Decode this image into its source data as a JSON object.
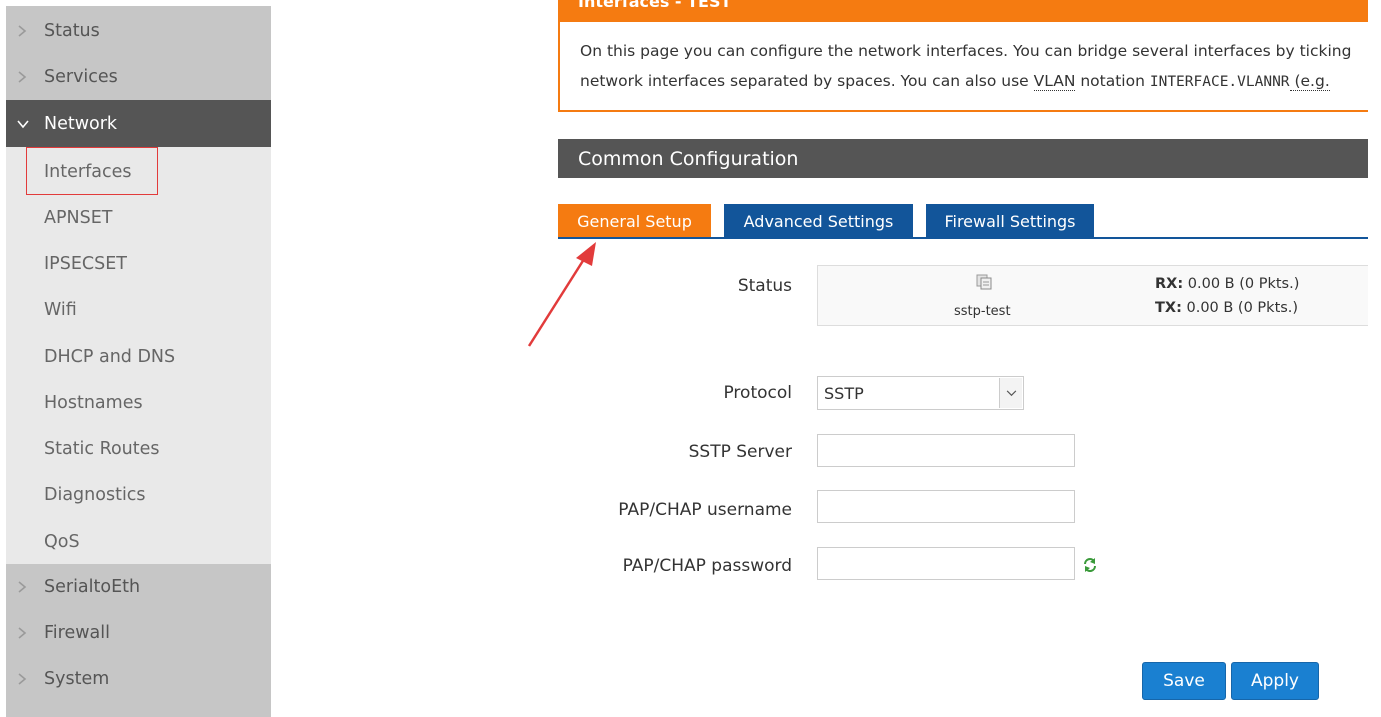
{
  "sidebar": {
    "items": [
      {
        "label": "Status"
      },
      {
        "label": "Services"
      },
      {
        "label": "Network"
      }
    ],
    "network_submenu": [
      {
        "label": "Interfaces"
      },
      {
        "label": "APNSET"
      },
      {
        "label": "IPSECSET"
      },
      {
        "label": "Wifi"
      },
      {
        "label": "DHCP and DNS"
      },
      {
        "label": "Hostnames"
      },
      {
        "label": "Static Routes"
      },
      {
        "label": "Diagnostics"
      },
      {
        "label": "QoS"
      }
    ],
    "bottom_items": [
      {
        "label": "SerialtoEth"
      },
      {
        "label": "Firewall"
      },
      {
        "label": "System"
      }
    ]
  },
  "page": {
    "title": "Interfaces - TEST",
    "description_line1": "On this page you can configure the network interfaces. You can bridge several interfaces by ticking",
    "description_line2_a": "network interfaces separated by spaces. You can also use ",
    "description_vlan": "VLAN",
    "description_line2_b": " notation ",
    "description_code": "INTERFACE.VLANNR",
    "description_line2_c": " (e.g.",
    "section_title": "Common Configuration"
  },
  "tabs": {
    "general": "General Setup",
    "advanced": "Advanced Settings",
    "firewall": "Firewall Settings"
  },
  "status": {
    "label": "Status",
    "interface_name": "sstp-test",
    "rx_label": "RX:",
    "rx_value": " 0.00 B (0 Pkts.)",
    "tx_label": "TX:",
    "tx_value": " 0.00 B (0 Pkts.)"
  },
  "form": {
    "protocol_label": "Protocol",
    "protocol_value": "SSTP",
    "server_label": "SSTP Server",
    "server_value": "",
    "username_label": "PAP/CHAP username",
    "username_value": "",
    "password_label": "PAP/CHAP password",
    "password_value": ""
  },
  "buttons": {
    "save": "Save",
    "apply": "Apply"
  },
  "colors": {
    "accent_orange": "#f57b11",
    "tab_blue": "#12559a",
    "button_blue": "#1a80d1",
    "sidebar_active": "#555555",
    "highlight_red": "#e23b3b"
  }
}
